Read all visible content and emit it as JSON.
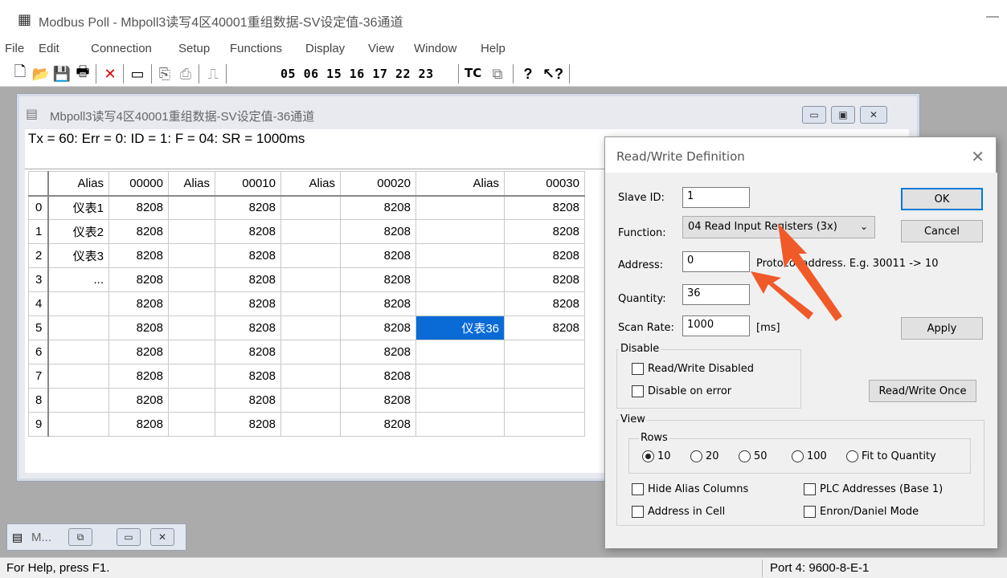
{
  "app": {
    "title": "Modbus Poll - Mbpoll3读写4区40001重组数据-SV设定值-36通道",
    "minimize_glyph": "—"
  },
  "menu": [
    "File",
    "Edit",
    "Connection",
    "Setup",
    "Functions",
    "Display",
    "View",
    "Window",
    "Help"
  ],
  "toolbar": {
    "function_codes": "05 06 15 16 17 22 23",
    "tc_label": "TC",
    "icons": [
      "new-icon",
      "open-icon",
      "save-icon",
      "print-icon",
      "delete-icon",
      "window-icon",
      "connect-icon",
      "disconnect-icon",
      "pulse-icon",
      "comm-traffic-icon",
      "help-icon",
      "context-help-icon"
    ]
  },
  "child_window": {
    "title": "Mbpoll3读写4区40001重组数据-SV设定值-36通道",
    "status": "Tx = 60: Err = 0: ID = 1: F = 04: SR = 1000ms",
    "columns": [
      "Alias",
      "00000",
      "Alias",
      "00010",
      "Alias",
      "00020",
      "Alias",
      "00030"
    ],
    "rows": [
      {
        "n": "0",
        "c": [
          "仪表1",
          "8208",
          "",
          "8208",
          "",
          "8208",
          "",
          "8208"
        ]
      },
      {
        "n": "1",
        "c": [
          "仪表2",
          "8208",
          "",
          "8208",
          "",
          "8208",
          "",
          "8208"
        ]
      },
      {
        "n": "2",
        "c": [
          "仪表3",
          "8208",
          "",
          "8208",
          "",
          "8208",
          "",
          "8208"
        ]
      },
      {
        "n": "3",
        "c": [
          "...",
          "8208",
          "",
          "8208",
          "",
          "8208",
          "",
          "8208"
        ]
      },
      {
        "n": "4",
        "c": [
          "",
          "8208",
          "",
          "8208",
          "",
          "8208",
          "",
          "8208"
        ]
      },
      {
        "n": "5",
        "c": [
          "",
          "8208",
          "",
          "8208",
          "",
          "8208",
          "仪表36",
          "8208"
        ]
      },
      {
        "n": "6",
        "c": [
          "",
          "8208",
          "",
          "8208",
          "",
          "8208",
          "",
          ""
        ]
      },
      {
        "n": "7",
        "c": [
          "",
          "8208",
          "",
          "8208",
          "",
          "8208",
          "",
          ""
        ]
      },
      {
        "n": "8",
        "c": [
          "",
          "8208",
          "",
          "8208",
          "",
          "8208",
          "",
          ""
        ]
      },
      {
        "n": "9",
        "c": [
          "",
          "8208",
          "",
          "8208",
          "",
          "8208",
          "",
          ""
        ]
      }
    ],
    "selected_cell": {
      "row": 5,
      "col": 6
    }
  },
  "minimized_window": {
    "label": "M..."
  },
  "statusbar": {
    "help": "For Help, press F1.",
    "port": "Port 4: 9600-8-E-1"
  },
  "dialog": {
    "title": "Read/Write Definition",
    "slave_id_label": "Slave ID:",
    "slave_id": "1",
    "function_label": "Function:",
    "function_value": "04 Read Input Registers (3x)",
    "address_label": "Address:",
    "address": "0",
    "address_hint": "Protocol address. E.g. 30011 -> 10",
    "quantity_label": "Quantity:",
    "quantity": "36",
    "scan_rate_label": "Scan Rate:",
    "scan_rate": "1000",
    "scan_unit": "[ms]",
    "ok": "OK",
    "cancel": "Cancel",
    "apply": "Apply",
    "read_write_once": "Read/Write Once",
    "disable_group": "Disable",
    "rw_disabled": "Read/Write Disabled",
    "disable_on_error": "Disable on error",
    "view_group": "View",
    "rows_group": "Rows",
    "row_options": [
      "10",
      "20",
      "50",
      "100",
      "Fit to Quantity"
    ],
    "row_selected": "10",
    "hide_alias": "Hide Alias Columns",
    "plc_addresses": "PLC Addresses (Base 1)",
    "address_in_cell": "Address in Cell",
    "enron": "Enron/Daniel Mode"
  },
  "colors": {
    "selection": "#0a6bd6",
    "arrow": "#f05a28",
    "ok_border": "#0078d7"
  }
}
